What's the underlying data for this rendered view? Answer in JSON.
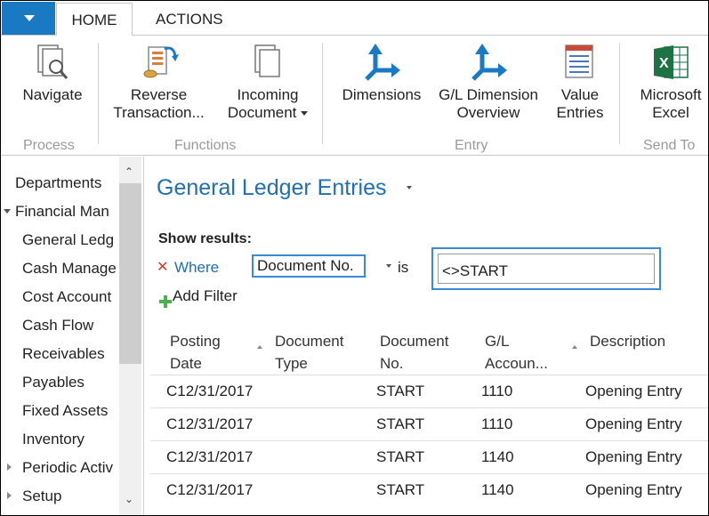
{
  "ribbon": {
    "tabs": [
      "HOME",
      "ACTIONS"
    ],
    "buttons": {
      "navigate": "Navigate",
      "reverse_1": "Reverse",
      "reverse_2": "Transaction...",
      "incoming_1": "Incoming",
      "incoming_2": "Document",
      "dimensions": "Dimensions",
      "gl_dim_1": "G/L Dimension",
      "gl_dim_2": "Overview",
      "value_1": "Value",
      "value_2": "Entries",
      "excel_1": "Microsoft",
      "excel_2": "Excel"
    },
    "groups": [
      "Process",
      "Functions",
      "Entry",
      "Send To"
    ]
  },
  "sidebar": {
    "items": [
      "Departments",
      "Financial Man",
      "General Ledg",
      "Cash Manage",
      "Cost Account",
      "Cash Flow",
      "Receivables",
      "Payables",
      "Fixed Assets",
      "Inventory",
      "Periodic Activ",
      "Setup"
    ]
  },
  "page": {
    "title": "General Ledger Entries",
    "filter": {
      "show_results": "Show results:",
      "where": "Where",
      "field": "Document No.",
      "operator": "is",
      "value": "<>START",
      "add_filter": "Add Filter"
    }
  },
  "table": {
    "headers": [
      {
        "l1": "Posting",
        "l2": "Date"
      },
      {
        "l1": "Document",
        "l2": "Type"
      },
      {
        "l1": "Document",
        "l2": "No."
      },
      {
        "l1": "G/L",
        "l2": "Accoun..."
      },
      {
        "l1": "Description",
        "l2": ""
      }
    ],
    "rows": [
      [
        "C12/31/2017",
        "",
        "START",
        "1110",
        "Opening Entry"
      ],
      [
        "C12/31/2017",
        "",
        "START",
        "1110",
        "Opening Entry"
      ],
      [
        "C12/31/2017",
        "",
        "START",
        "1140",
        "Opening Entry"
      ],
      [
        "C12/31/2017",
        "",
        "START",
        "1140",
        "Opening Entry"
      ]
    ]
  },
  "colors": {
    "accent": "#1979c3",
    "title": "#1f6fb5",
    "focus": "#3b8ad9",
    "remove": "#d43a2a",
    "add": "#4caf50",
    "excel": "#1f7244"
  }
}
